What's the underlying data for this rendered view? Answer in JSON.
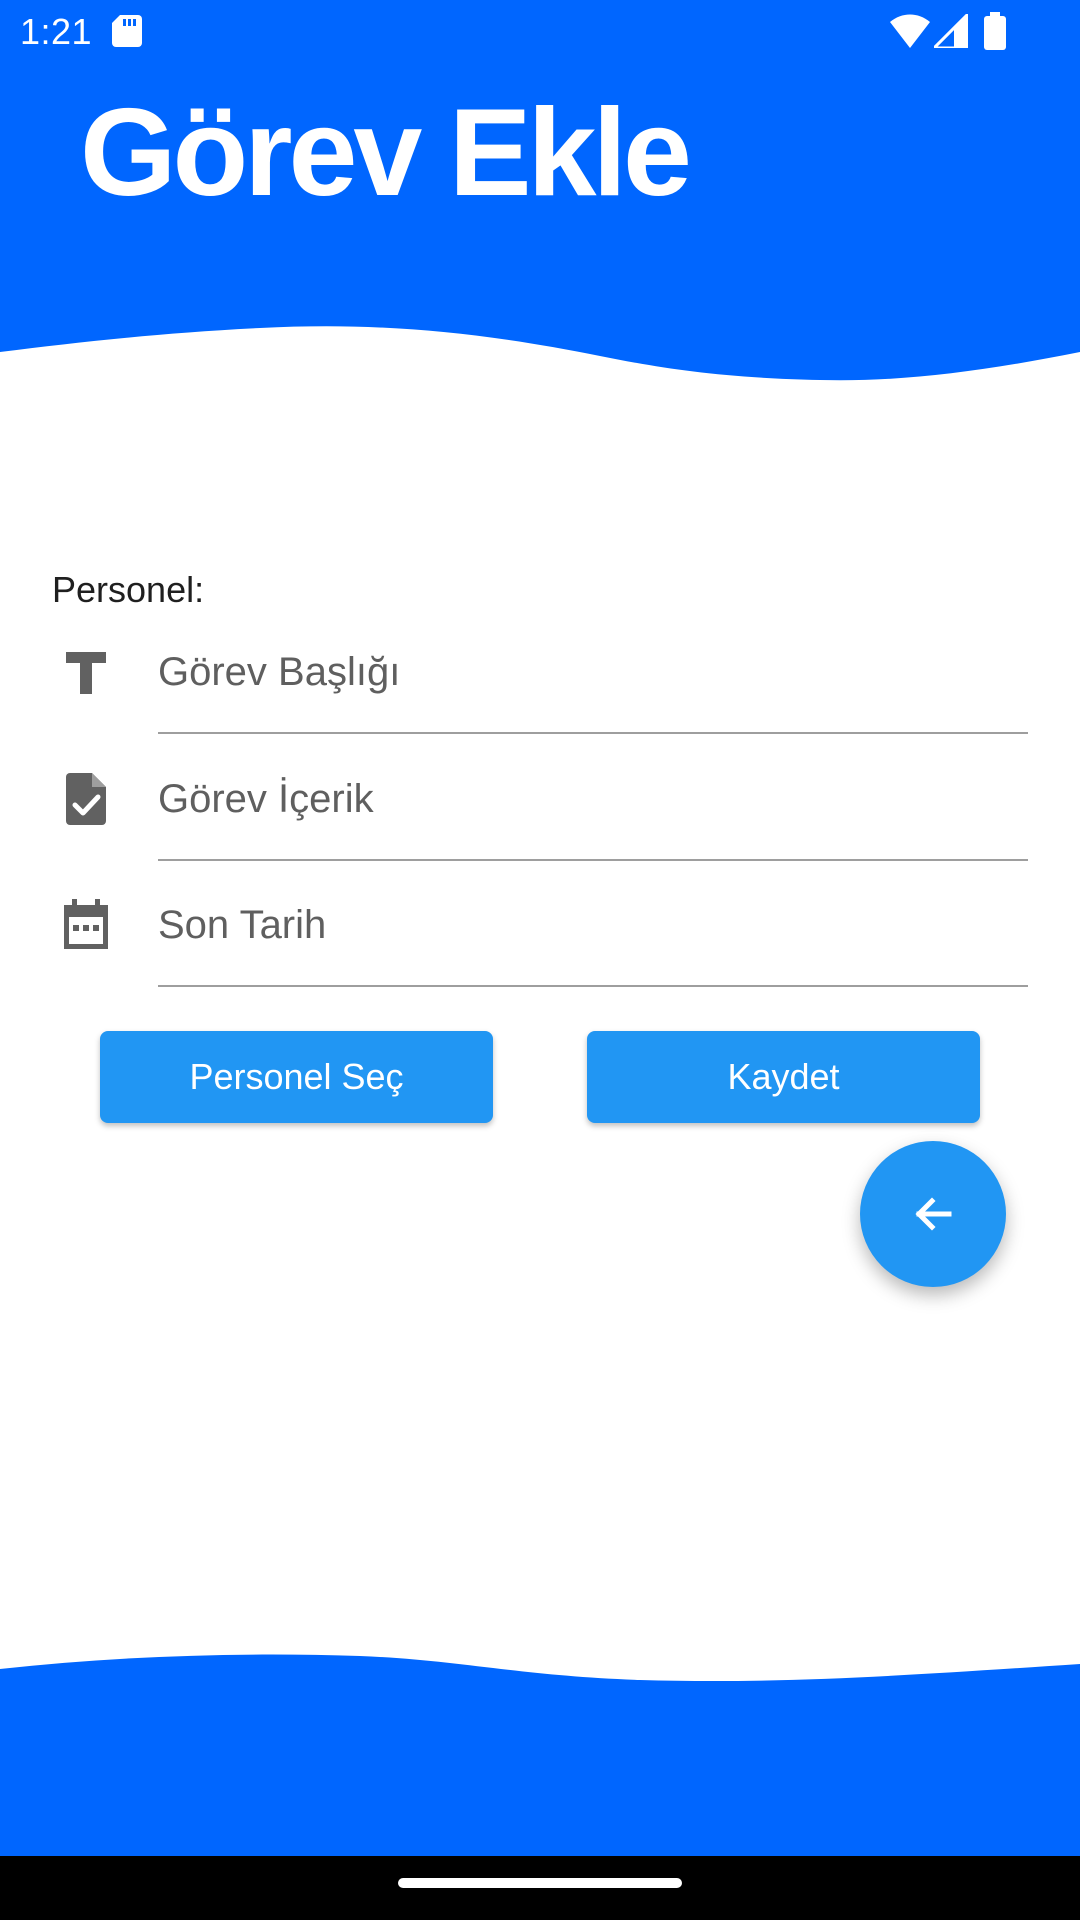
{
  "status_bar": {
    "time": "1:21",
    "icons": [
      "sd-card-icon",
      "wifi-icon",
      "signal-icon",
      "battery-icon"
    ]
  },
  "header": {
    "title": "Görev Ekle"
  },
  "form": {
    "personel_label": "Personel:",
    "fields": [
      {
        "icon": "title-text-icon",
        "placeholder": "Görev Başlığı",
        "value": ""
      },
      {
        "icon": "document-check-icon",
        "placeholder": "Görev İçerik",
        "value": ""
      },
      {
        "icon": "calendar-icon",
        "placeholder": "Son Tarih",
        "value": ""
      }
    ]
  },
  "buttons": {
    "select_personel": "Personel Seç",
    "save": "Kaydet",
    "back_fab_icon": "arrow-back-icon"
  },
  "colors": {
    "brand_blue": "#0066ff",
    "button_blue": "#2196f3",
    "icon_gray": "#616161"
  }
}
